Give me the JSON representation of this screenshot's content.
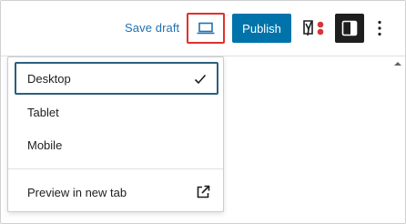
{
  "toolbar": {
    "save_draft_label": "Save draft",
    "preview_icon": "laptop-icon",
    "publish_label": "Publish",
    "yoast_icon": "yoast-seo-icon",
    "settings_icon": "sidebar-toggle-icon",
    "more_icon": "more-vertical-icon"
  },
  "preview_menu": {
    "items": [
      {
        "label": "Desktop",
        "selected": true
      },
      {
        "label": "Tablet",
        "selected": false
      },
      {
        "label": "Mobile",
        "selected": false
      }
    ],
    "check_icon": "checkmark-icon",
    "preview_new_tab_label": "Preview in new tab",
    "external_icon": "external-link-icon"
  },
  "colors": {
    "accent": "#0073aa",
    "link": "#2271b1",
    "highlight_border": "#e0312c",
    "selected_border": "#2c5f7c",
    "dark_button": "#1e1e1e",
    "yoast_red": "#d63638"
  }
}
